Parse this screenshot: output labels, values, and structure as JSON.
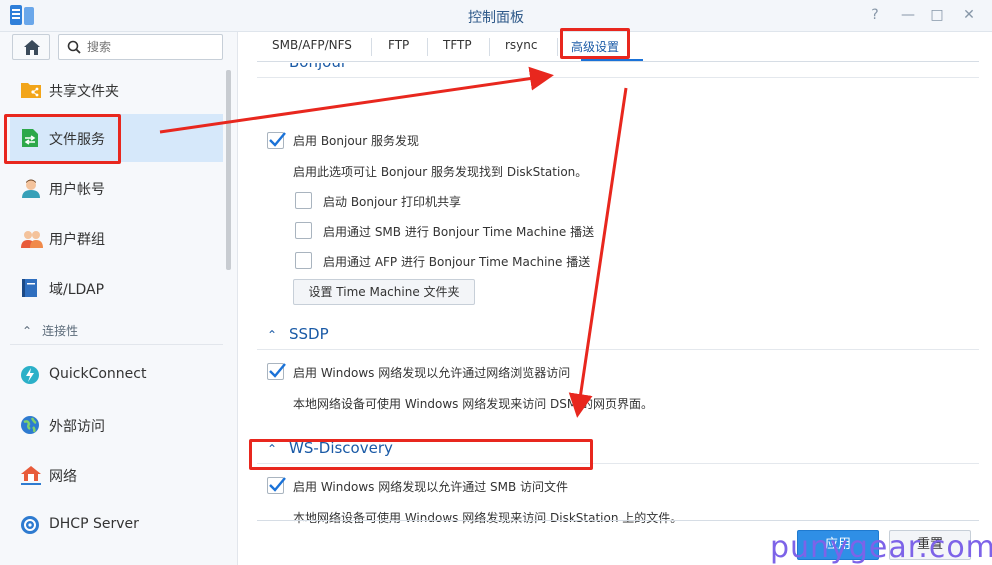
{
  "window": {
    "title": "控制面板",
    "controls": [
      "?",
      "—",
      "□",
      "✕"
    ]
  },
  "sidebar": {
    "search_placeholder": "搜索",
    "items": [
      {
        "label": "共享文件夹",
        "icon": "shared-folder-icon"
      },
      {
        "label": "文件服务",
        "icon": "file-services-icon",
        "active": true
      },
      {
        "label": "用户帐号",
        "icon": "user-icon"
      },
      {
        "label": "用户群组",
        "icon": "group-icon"
      },
      {
        "label": "域/LDAP",
        "icon": "ldap-icon"
      }
    ],
    "section_label": "连接性",
    "connectivity": [
      {
        "label": "QuickConnect",
        "icon": "quickconnect-icon"
      },
      {
        "label": "外部访问",
        "icon": "external-access-icon"
      },
      {
        "label": "网络",
        "icon": "network-icon"
      },
      {
        "label": "DHCP Server",
        "icon": "dhcp-icon"
      }
    ]
  },
  "tabs": [
    "SMB/AFP/NFS",
    "FTP",
    "TFTP",
    "rsync",
    "高级设置"
  ],
  "active_tab": "高级设置",
  "bonjour": {
    "title": "Bonjour",
    "enable_label": "启用 Bonjour 服务发现",
    "enable_checked": true,
    "description": "启用此选项可让 Bonjour 服务发现找到 DiskStation。",
    "printer_label": "启动 Bonjour 打印机共享",
    "smb_tm_label": "启用通过 SMB 进行 Bonjour Time Machine 播送",
    "afp_tm_label": "启用通过 AFP 进行 Bonjour Time Machine 播送",
    "tm_button": "设置 Time Machine 文件夹"
  },
  "ssdp": {
    "title": "SSDP",
    "enable_label": "启用 Windows 网络发现以允许通过网络浏览器访问",
    "enable_checked": true,
    "description": "本地网络设备可使用 Windows 网络发现来访问 DSM 的网页界面。"
  },
  "wsd": {
    "title": "WS-Discovery",
    "enable_label": "启用 Windows 网络发现以允许通过 SMB 访问文件",
    "enable_checked": true,
    "description": "本地网络设备可使用 Windows 网络发现来访问 DiskStation 上的文件。"
  },
  "footer": {
    "apply": "应用",
    "reset": "重置"
  },
  "watermark": "punygear.com",
  "colors": {
    "accent": "#1a72d8",
    "annotation": "#e8271e",
    "watermark": "#7d63e8"
  }
}
